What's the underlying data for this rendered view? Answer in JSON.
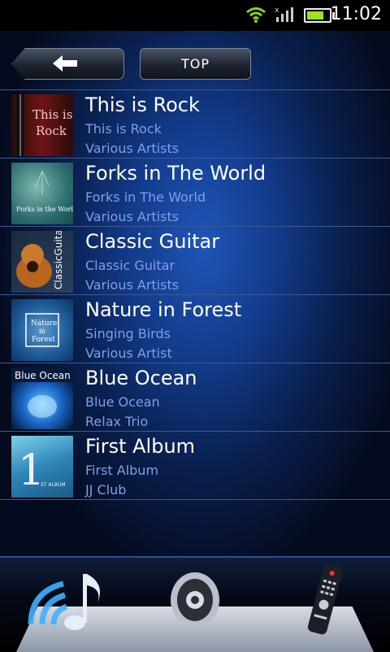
{
  "status_bar": {
    "time": "11:02"
  },
  "toolbar": {
    "top_label": "TOP"
  },
  "albums": [
    {
      "title": "This is Rock",
      "album": "This is Rock",
      "artist": "Various Artists",
      "art_text": "This is Rock"
    },
    {
      "title": "Forks in The World",
      "album": "Forks in The World",
      "artist": "Various Artists",
      "art_text": "Forks in the World"
    },
    {
      "title": "Classic Guitar",
      "album": "Classic Guitar",
      "artist": "Various Artists",
      "art_text": "ClassicGuitar"
    },
    {
      "title": "Nature in Forest",
      "album": "Singing Birds",
      "artist": "Various Artist",
      "art_text": "Nature in Forest"
    },
    {
      "title": "Blue Ocean",
      "album": "Blue Ocean",
      "artist": "Relax Trio",
      "art_text": "Blue Ocean"
    },
    {
      "title": "First Album",
      "album": "First Album",
      "artist": "JJ Club",
      "art_text": "1"
    }
  ],
  "bottom_tabs": [
    "music-icon",
    "speaker-icon",
    "remote-icon"
  ],
  "colors": {
    "accent": "#7e9fe6",
    "background": "#123b8a"
  }
}
